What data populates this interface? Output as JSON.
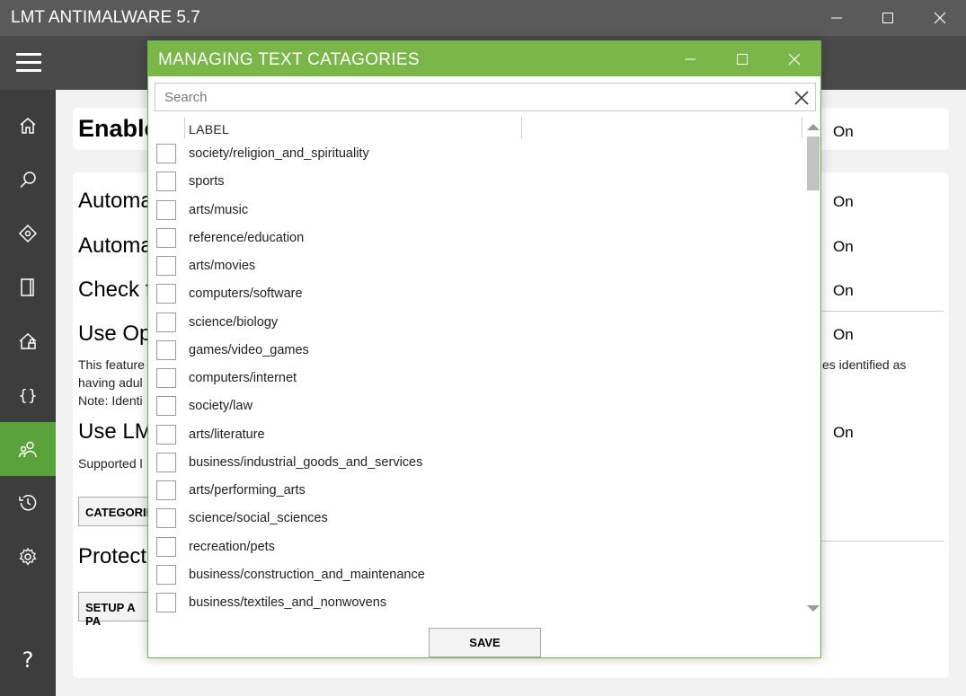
{
  "app": {
    "title": "LMT ANTIMALWARE 5.7"
  },
  "window_controls": {
    "minimize": "–",
    "maximize": "☐",
    "close": "✕"
  },
  "background": {
    "enable_text": "Enable",
    "on_label": "On",
    "rows": [
      "Automa",
      "Automa",
      "Check f",
      "Use Op",
      "Use LM",
      "Protect"
    ],
    "desc_line1_left": "This feature",
    "desc_line1_right": "es identified as",
    "desc_line2": "having adul",
    "desc_line3": "Note: Identi",
    "supported_text": "Supported l",
    "categories_button": "CATEGORIES",
    "setup_button": "SETUP A PA"
  },
  "dialog": {
    "title": "MANAGING TEXT CATAGORIES",
    "search_placeholder": "Search",
    "column_header": "LABEL",
    "save_label": "SAVE",
    "items": [
      {
        "label": "society/religion_and_spirituality",
        "checked": false
      },
      {
        "label": "sports",
        "checked": false
      },
      {
        "label": "arts/music",
        "checked": false
      },
      {
        "label": "reference/education",
        "checked": false
      },
      {
        "label": "arts/movies",
        "checked": false
      },
      {
        "label": "computers/software",
        "checked": false
      },
      {
        "label": "science/biology",
        "checked": false
      },
      {
        "label": "games/video_games",
        "checked": false
      },
      {
        "label": "computers/internet",
        "checked": false
      },
      {
        "label": "society/law",
        "checked": false
      },
      {
        "label": "arts/literature",
        "checked": false
      },
      {
        "label": "business/industrial_goods_and_services",
        "checked": false
      },
      {
        "label": "arts/performing_arts",
        "checked": false
      },
      {
        "label": "science/social_sciences",
        "checked": false
      },
      {
        "label": "recreation/pets",
        "checked": false
      },
      {
        "label": "business/construction_and_maintenance",
        "checked": false
      },
      {
        "label": "business/textiles_and_nonwovens",
        "checked": false
      }
    ]
  },
  "sidebar": {
    "items": [
      {
        "icon": "home-icon"
      },
      {
        "icon": "search-icon"
      },
      {
        "icon": "scan-target-icon"
      },
      {
        "icon": "document-icon"
      },
      {
        "icon": "home-shield-icon"
      },
      {
        "icon": "braces-icon"
      },
      {
        "icon": "users-icon",
        "active": true
      },
      {
        "icon": "history-icon"
      },
      {
        "icon": "gear-icon"
      },
      {
        "icon": "help-icon"
      }
    ],
    "help_glyph": "?"
  },
  "colors": {
    "accent": "#7ab648",
    "active_nav": "#5aa33b",
    "sidebar": "#3d3d3d",
    "titlebar": "#5a5a5a"
  }
}
